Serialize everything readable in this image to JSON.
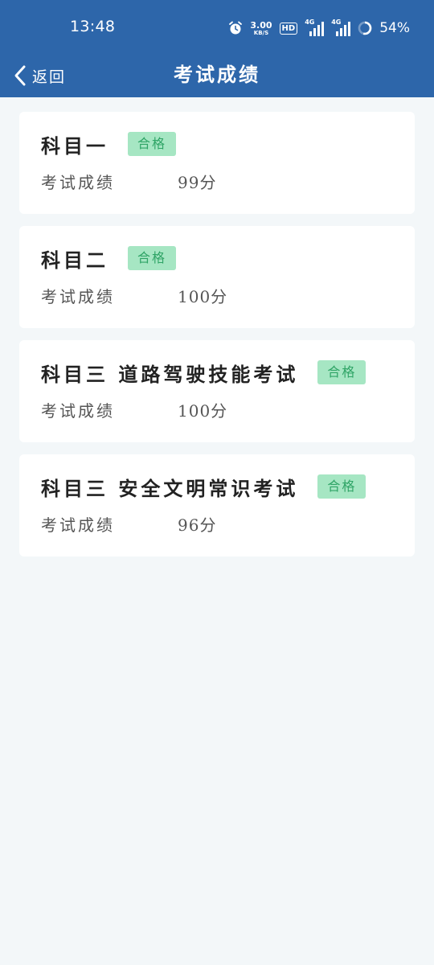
{
  "status_bar": {
    "time": "13:48",
    "net_speed_value": "3.00",
    "net_speed_unit": "KB/S",
    "hd_label": "HD",
    "sim1_label": "4G",
    "sim2_label": "4G",
    "battery": "54%",
    "icons": [
      "alarm-icon",
      "hd-icon",
      "signal-icon",
      "signal-icon",
      "battery-icon"
    ]
  },
  "nav": {
    "back_label": "返回",
    "title": "考试成绩"
  },
  "results": [
    {
      "subject": "科目一",
      "status": "合格",
      "score_label": "考试成绩",
      "score": "99分"
    },
    {
      "subject": "科目二",
      "status": "合格",
      "score_label": "考试成绩",
      "score": "100分"
    },
    {
      "subject": "科目三 道路驾驶技能考试",
      "status": "合格",
      "score_label": "考试成绩",
      "score": "100分"
    },
    {
      "subject": "科目三 安全文明常识考试",
      "status": "合格",
      "score_label": "考试成绩",
      "score": "96分"
    }
  ],
  "colors": {
    "header": "#2d66aa",
    "background": "#f3f7f9",
    "pass_badge_bg": "#a6e6c3",
    "pass_badge_text": "#2fa466"
  }
}
